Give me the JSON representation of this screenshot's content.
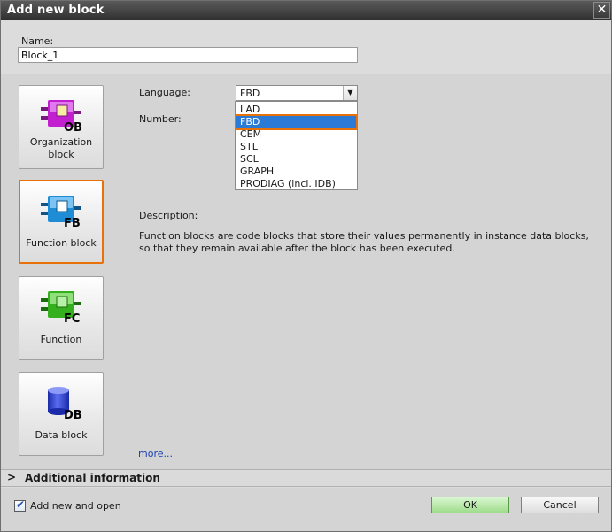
{
  "window": {
    "title": "Add new block",
    "close_glyph": "✕"
  },
  "name": {
    "label": "Name:",
    "value": "Block_1"
  },
  "tiles": [
    {
      "id": "ob",
      "letters": "OB",
      "label": "Organization block",
      "color": "#c21fd1",
      "icon": "organization-block-icon",
      "selected": false
    },
    {
      "id": "fb",
      "letters": "FB",
      "label": "Function block",
      "color": "#1f8cd6",
      "icon": "function-block-icon",
      "selected": true
    },
    {
      "id": "fc",
      "letters": "FC",
      "label": "Function",
      "color": "#34b01e",
      "icon": "function-icon",
      "selected": false
    },
    {
      "id": "db",
      "letters": "DB",
      "label": "Data block",
      "color": "#2f44d8",
      "icon": "data-block-icon",
      "selected": false
    }
  ],
  "form": {
    "language_label": "Language:",
    "number_label": "Number:",
    "language_value": "FBD",
    "language_options": [
      "LAD",
      "FBD",
      "CEM",
      "STL",
      "SCL",
      "GRAPH",
      "PRODIAG (incl. IDB)"
    ],
    "highlighted_option": "FBD"
  },
  "description": {
    "label": "Description:",
    "line1": "Function blocks are code blocks that store their values permanently in instance data blocks,",
    "line2": "so that they remain available after the block has been executed."
  },
  "more_link": "more...",
  "additional_info": {
    "chevron": ">",
    "label": "Additional information"
  },
  "footer": {
    "checkbox_label": "Add new and open",
    "checkbox_checked": true,
    "ok_label": "OK",
    "cancel_label": "Cancel"
  },
  "colors": {
    "accent_orange": "#e8710a",
    "selection_blue": "#2a7ad6",
    "ok_green": "#9fdc8c"
  }
}
